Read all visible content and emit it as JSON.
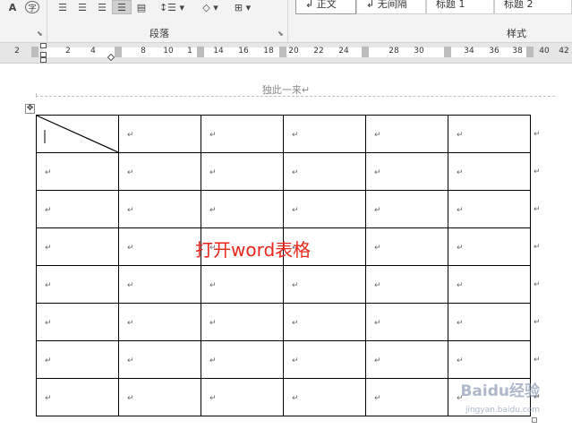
{
  "ribbon": {
    "paragraph_group_label": "段落",
    "styles_group_label": "样式",
    "styles": [
      "↲ 正文",
      "↲ 无间隔",
      "标题 1",
      "标题 2"
    ],
    "font_button_a": "A",
    "font_button_zi": "字"
  },
  "ruler": {
    "labels": [
      "2",
      "2",
      "4",
      "8",
      "10",
      "1",
      "14",
      "16",
      "18",
      "20",
      "22",
      "24",
      "28",
      "30",
      "34",
      "36",
      "38",
      "40",
      "42"
    ]
  },
  "document": {
    "header_text": "独此一来↵",
    "cell_mark": "↵",
    "rows": 8,
    "cols": 6,
    "overlay_caption": "打开word表格",
    "watermark": "Baidu经验",
    "watermark_sub": "jingyan.baidu.com"
  }
}
